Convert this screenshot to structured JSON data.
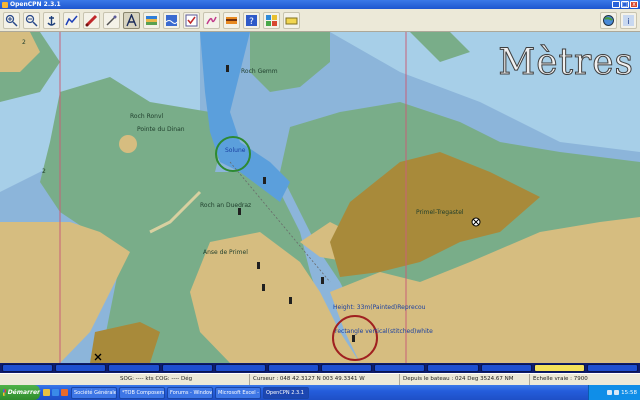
{
  "window": {
    "title": "OpenCPN 2.3.1",
    "min": "_",
    "max": "□",
    "close": "x"
  },
  "toolbar": {
    "buttons": [
      {
        "name": "zoom-in-icon"
      },
      {
        "name": "zoom-out-icon"
      },
      {
        "name": "anchor-icon"
      },
      {
        "name": "track-icon"
      },
      {
        "name": "route-icon"
      },
      {
        "name": "ruler-icon"
      },
      {
        "name": "text-icon"
      },
      {
        "name": "chart-icon"
      },
      {
        "name": "tide-icon"
      },
      {
        "name": "settings-icon"
      },
      {
        "name": "curve-icon"
      },
      {
        "name": "lifebuoy-icon"
      },
      {
        "name": "help-icon"
      },
      {
        "name": "plugins-icon"
      },
      {
        "name": "print-icon"
      }
    ],
    "right_buttons": [
      {
        "name": "globe-icon"
      },
      {
        "name": "info-icon"
      }
    ]
  },
  "chart": {
    "units": "Mètres",
    "labels": {
      "roch_gemm": "Roch Gemm",
      "roch_ronvl": "Roch Ronvl",
      "pointe_dinan": "Pointe du Dinan",
      "solune": "Solune",
      "roch_duedraz": "Roch an Duedraz",
      "anse_primel": "Anse de Primel",
      "primel_trepastr": "Primel-Tregastel",
      "light_label": "Height: 33m(Painted)Reprecou",
      "rect_label": "rectangle vertical(stitched)white"
    },
    "sounding_a": "2",
    "sounding_b": "2"
  },
  "piano": {
    "count": 12,
    "selected": 10
  },
  "status": {
    "sog": "SOG: ---- kts   COG: ----   Dég",
    "cursor": "Curseur : 048 42.3127 N 003 49.3341 W",
    "bearing": "Depuis le bateau : 024 Deg     3524.67 NM",
    "scale": "Echelle vraie :        7900"
  },
  "taskbar": {
    "start": "Démarrer",
    "tasks": [
      "Société Générale - Sourc...",
      "*TOB Composers - Arl...",
      "Forums - Windows Inter...",
      "Microsoft Excel - Siemens...",
      "OpenCPN 2.3.1"
    ],
    "clock": "15:58"
  }
}
